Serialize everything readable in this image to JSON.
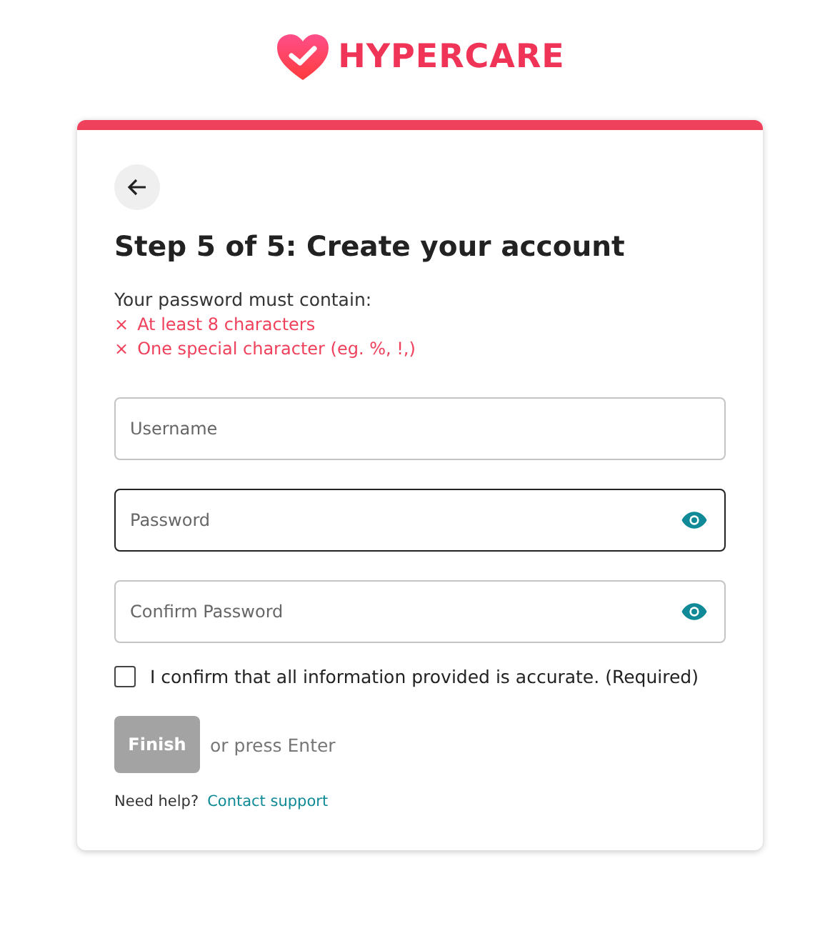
{
  "brand": {
    "name": "HYPERCARE"
  },
  "card": {
    "title": "Step 5 of 5: Create your account",
    "requirements_intro": "Your password must contain:",
    "requirements": [
      {
        "icon": "×",
        "label": "At least 8 characters",
        "met": false
      },
      {
        "icon": "×",
        "label": "One special character (eg. %, !,)",
        "met": false
      }
    ],
    "fields": [
      {
        "kind": "text",
        "placeholder": "Username",
        "focused": false
      },
      {
        "kind": "password",
        "placeholder": "Password",
        "focused": true
      },
      {
        "kind": "password",
        "placeholder": "Confirm Password",
        "focused": false
      }
    ],
    "confirm": {
      "label": "I confirm that all information provided is accurate. (Required)",
      "checked": false
    },
    "finish": {
      "label": "Finish",
      "disabled": true,
      "hint": "or press Enter"
    },
    "help": {
      "text": "Need help?",
      "link": "Contact support"
    }
  }
}
